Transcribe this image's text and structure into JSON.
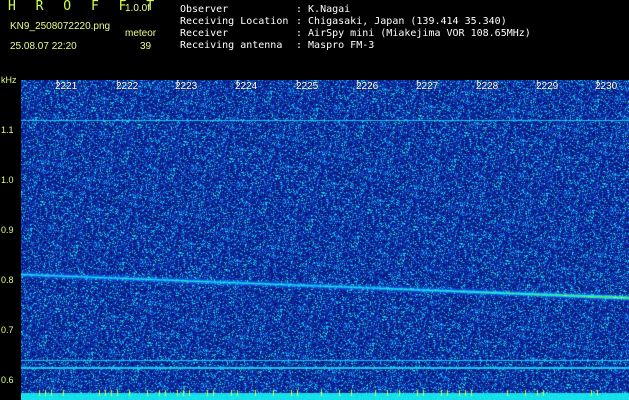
{
  "header": {
    "brand": "H R O F F T",
    "version": "1.0.0f",
    "filename": "KN9_2508072220.png",
    "label_meteor": "meteor",
    "meteor_count": "39",
    "datetime": "25.08.07 22:20"
  },
  "info": {
    "labels": [
      "Observer",
      "Receiving Location",
      "Receiver",
      "Receiving antenna"
    ],
    "values": [
      ": K.Nagai",
      ": Chigasaki, Japan (139.414 35.340)",
      ": AirSpy mini (Miakejima VOR 108.65MHz)",
      ": Maspro FM-3"
    ]
  },
  "axis": {
    "unit_label": "kHz",
    "y_ticks": [
      "1.1",
      "1.0",
      "0.9",
      "0.8",
      "0.7",
      "0.6"
    ],
    "x_ticks": [
      "2221",
      "2222",
      "2223",
      "2224",
      "2225",
      "2226",
      "2227",
      "2228",
      "2229",
      "2230"
    ]
  },
  "colors": {
    "background": "#000000",
    "spectrogram_base": "#0a1a8c",
    "signal": "#3cff60",
    "header_text": "#e8ff8a"
  }
}
